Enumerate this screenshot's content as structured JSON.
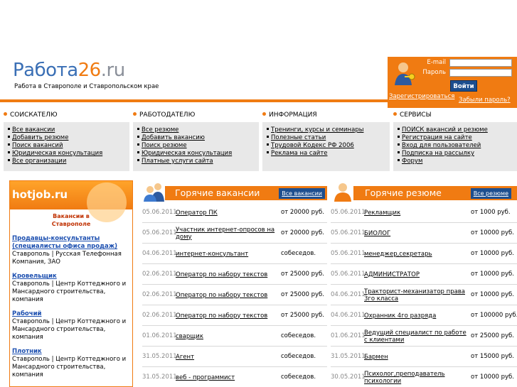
{
  "header": {
    "logo_part1": "Работа",
    "logo_part2": "26",
    "logo_part3": ".ru",
    "tagline": "Работа в Ставрополе и Ставропольском крае"
  },
  "login": {
    "email_label": "E-mail",
    "password_label": "Пароль",
    "submit_label": "Войти",
    "register_link": "Зарегистрироваться",
    "forgot_link": "Забыли пароль?"
  },
  "sections": [
    {
      "title": "СОИСКАТЕЛЮ",
      "items": [
        "Все вакансии",
        "Добавить резюме",
        "Поиск вакансий",
        "Юридическая консультация",
        "Все организации"
      ]
    },
    {
      "title": "РАБОТОДАТЕЛЮ",
      "items": [
        "Все резюме",
        "Добавить вакансию",
        "Поиск резюме",
        "Юридическая консультация",
        "Платные услуги сайта"
      ]
    },
    {
      "title": "ИНФОРМАЦИЯ",
      "items": [
        "Тренинги, курсы и семинары",
        "Полезные статьи",
        "Трудовой Кодекс РФ 2006",
        "Реклама на сайте"
      ]
    },
    {
      "title": "СЕРВИСЫ",
      "items": [
        "ПОИСК вакансий и резюме",
        "Регистрация на сайте",
        "Вход для пользователей",
        "Подписка на рассылку",
        "Форум"
      ]
    }
  ],
  "hotjob": {
    "logo": "hotjob.ru",
    "subtitle": "Вакансии в Ставрополе",
    "entries": [
      {
        "title": "Продавцы-консультанты (специалисты офиса продаж)",
        "desc": "Ставрополь | Русская Телефонная Компания, ЗАО"
      },
      {
        "title": "Кровельщик",
        "desc": "Ставрополь | Центр Коттеджного и Мансардного строительства, компания"
      },
      {
        "title": "Рабочий",
        "desc": "Ставрополь | Центр Коттеджного и Мансардного строительства, компания"
      },
      {
        "title": "Плотник",
        "desc": "Ставрополь | Центр Коттеджного и Мансардного строительства, компания"
      }
    ]
  },
  "hot_vacancies": {
    "title": "Горячие вакансии",
    "all_link": "Все вакансии",
    "rows": [
      {
        "date": "05.06.2011",
        "position": "Оператор ПК",
        "salary": "от   20000 руб."
      },
      {
        "date": "05.06.2011",
        "position": "Участник интернет-опросов на дому",
        "salary": "от   20000 руб."
      },
      {
        "date": "04.06.2011",
        "position": "интернет-консультант",
        "salary": "собеседов."
      },
      {
        "date": "02.06.2011",
        "position": "Оператор по набору текстов",
        "salary": "от   25000 руб."
      },
      {
        "date": "02.06.2011",
        "position": "Оператор по набору текстов",
        "salary": "от   25000 руб."
      },
      {
        "date": "02.06.2011",
        "position": "Оператор по набору текстов",
        "salary": "от   25000 руб."
      },
      {
        "date": "01.06.2011",
        "position": "сварщик",
        "salary": "собеседов."
      },
      {
        "date": "31.05.2011",
        "position": "Агент",
        "salary": "собеседов."
      },
      {
        "date": "31.05.2011",
        "position": "веб - программист",
        "salary": "собеседов."
      }
    ]
  },
  "hot_resumes": {
    "title": "Горячие резюме",
    "all_link": "Все резюме",
    "rows": [
      {
        "date": "05.06.2011",
        "position": "Рекламщик",
        "salary": "от 1000 руб."
      },
      {
        "date": "05.06.2011",
        "position": "БИОЛОГ",
        "salary": "от 10000 руб."
      },
      {
        "date": "05.06.2011",
        "position": "менеджер,секретарь",
        "salary": "от 10000 руб."
      },
      {
        "date": "05.06.2011",
        "position": "АДМИНИСТРАТОР",
        "salary": "от 10000 руб."
      },
      {
        "date": "04.06.2011",
        "position": "Тракторист-механизатор права 3го класса",
        "salary": "от 10000 руб."
      },
      {
        "date": "04.06.2011",
        "position": "Охранник 4го разряда",
        "salary": "от 100000 руб."
      },
      {
        "date": "01.06.2011",
        "position": "Ведущий специалист по работе с клиентами",
        "salary": "от 25000 руб."
      },
      {
        "date": "31.05.2011",
        "position": "Бармен",
        "salary": "от 15000 руб."
      },
      {
        "date": "30.05.2011",
        "position": "Психолог,преподаватель психологии",
        "salary": "от 10000 руб."
      }
    ]
  },
  "colors": {
    "accent": "#f07b12",
    "navy": "#1d4e8e",
    "link_blue": "#1c4fb0",
    "logo_blue": "#3a6fb5"
  }
}
